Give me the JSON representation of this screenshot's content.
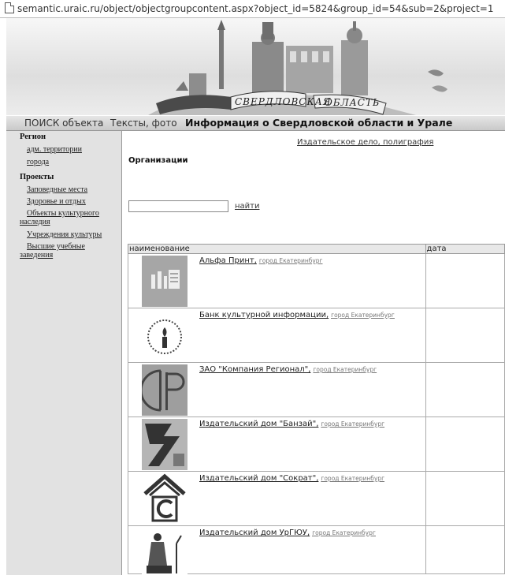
{
  "browser": {
    "url": "semantic.uraic.ru/object/objectgroupcontent.aspx?object_id=5824&group_id=54&sub=2&project=1"
  },
  "banner": {
    "ribbon_left": "СВЕРДЛОВСКАЯ",
    "ribbon_right": "ОБЛАСТЬ"
  },
  "nav": {
    "search": "ПОИСК объекта",
    "texts": "Тексты, фото",
    "info": "Информация о Свердловской области и Урале"
  },
  "sidebar": {
    "region_heading": "Регион",
    "region_items": [
      "адм. территории",
      "города"
    ],
    "projects_heading": "Проекты",
    "project_items": [
      "Заповедные места",
      "Здоровье и отдых",
      "Объекты культурного наследия",
      "Учреждения культуры",
      "Высшие учебные заведения"
    ]
  },
  "main": {
    "category_link": "Издательское дело, полиграфия",
    "section_title": "Организации",
    "search_value": "",
    "search_button": "найти",
    "columns": [
      "наименование",
      "дата"
    ],
    "rows": [
      {
        "name": "Альфа Принт,",
        "city": "город Екатеринбург",
        "logo": "factory-icon"
      },
      {
        "name": "Банк культурной информации,",
        "city": "город Екатеринбург",
        "logo": "candle-seal-icon"
      },
      {
        "name": "ЗАО \"Компания Регионал\",",
        "city": "город Екатеринбург",
        "logo": "ctp-monogram-icon"
      },
      {
        "name": "Издательский дом \"Банзай\",",
        "city": "город Екатеринбург",
        "logo": "banzai-logo-icon"
      },
      {
        "name": "Издательский дом \"Сократ\",",
        "city": "город Екатеринбург",
        "logo": "house-c-icon"
      },
      {
        "name": "Издательский дом УрГЮУ,",
        "city": "город Екатеринбург",
        "logo": "statue-icon"
      }
    ]
  }
}
